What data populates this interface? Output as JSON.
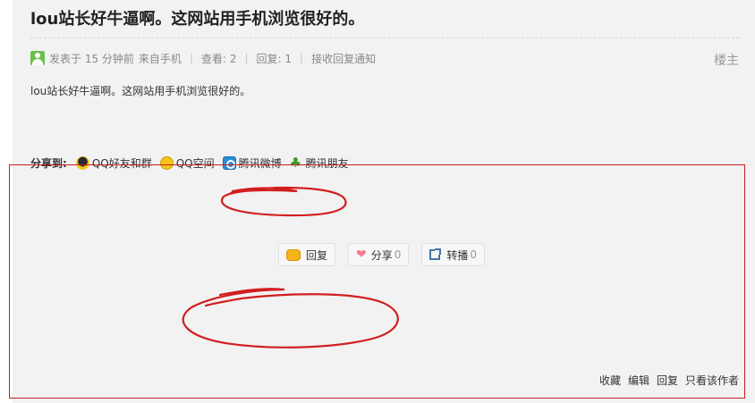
{
  "post": {
    "title": "lou站长好牛逼啊。这网站用手机浏览很好的。",
    "meta": {
      "posted": "发表于 15 分钟前",
      "source": "来自手机",
      "views": "查看: 2",
      "replies": "回复: 1",
      "notify": "接收回复通知"
    },
    "floor": "楼主",
    "body": "lou站长好牛逼啊。这网站用手机浏览很好的。"
  },
  "share": {
    "label": "分享到:",
    "items": [
      {
        "label": "QQ好友和群",
        "icon": "qq-icon"
      },
      {
        "label": "QQ空间",
        "icon": "qzone-icon"
      },
      {
        "label": "腾讯微博",
        "icon": "tencent-weibo-icon"
      },
      {
        "label": "腾讯朋友",
        "icon": "tencent-pengyou-icon"
      }
    ]
  },
  "actions": {
    "reply_label": "回复",
    "share_label": "分享",
    "share_count": "0",
    "forward_label": "转播",
    "forward_count": "0"
  },
  "footer": {
    "favorite": "收藏",
    "edit": "编辑",
    "reply": "回复",
    "author_only": "只看该作者"
  },
  "annotation_color": "#c81e1e"
}
